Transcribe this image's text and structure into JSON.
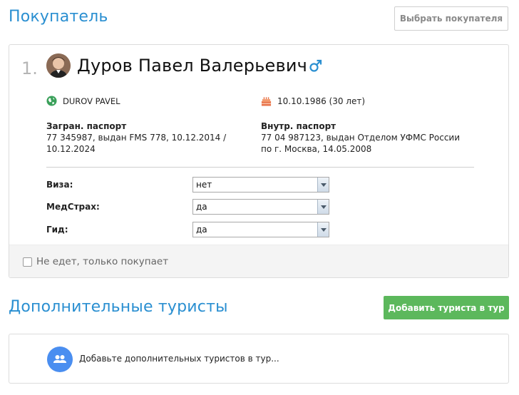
{
  "buyer_section": {
    "title": "Покупатель",
    "choose_button": "Выбрать покупателя"
  },
  "buyer": {
    "number": "1.",
    "full_name": "Дуров Павел Валерьевич",
    "gender_icon": "male-icon",
    "latin_name": "DUROV PAVEL",
    "birth": "10.10.1986 (30 лет)",
    "foreign_passport": {
      "label": "Загран. паспорт",
      "line1": "77 345987, выдан FMS 778, 10.12.2014 /",
      "line2": "10.12.2024"
    },
    "internal_passport": {
      "label": "Внутр. паспорт",
      "line1": "77 04 987123, выдан Отделом УФМС России",
      "line2": "по г. Москва, 14.05.2008"
    },
    "options": {
      "visa": {
        "label": "Виза:",
        "value": "нет"
      },
      "medical": {
        "label": "МедСтрах:",
        "value": "да"
      },
      "guide": {
        "label": "Гид:",
        "value": "да"
      }
    },
    "not_travelling_label": "Не едет, только покупает",
    "not_travelling_checked": false
  },
  "extra_section": {
    "title": "Дополнительные туристы",
    "add_button": "Добавить туриста в тур",
    "hint": "Добавьте дополнительных туристов в тур..."
  },
  "colors": {
    "accent": "#2a8fd1",
    "add_button": "#5cb85c",
    "group_icon_bg": "#4a8ef0",
    "globe_icon": "#3aa05a",
    "cake_icon": "#e8734a"
  }
}
